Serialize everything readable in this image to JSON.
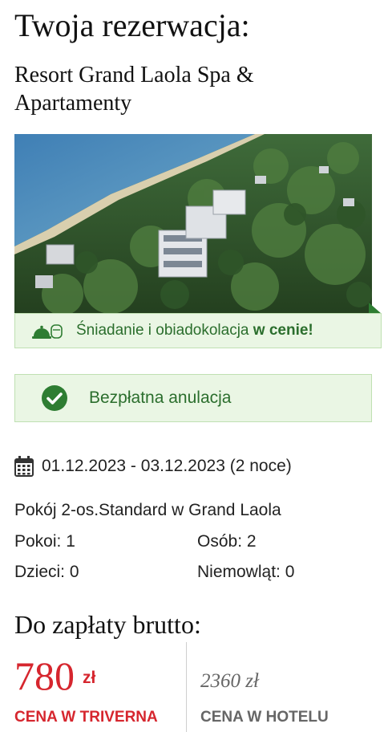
{
  "header": {
    "title": "Twoja rezerwacja:",
    "hotel_name": "Resort Grand Laola Spa & Apartamenty"
  },
  "photo": {
    "description_icon": "hotel-aerial-photo"
  },
  "meal_banner": {
    "text": "Śniadanie i obiadokolacja",
    "emphasis": "w cenie!",
    "icon": "meal-icon"
  },
  "cancellation": {
    "text": "Bezpłatna anulacja",
    "icon": "check-circle-icon"
  },
  "stay": {
    "dates": "01.12.2023 - 03.12.2023 (2 noce)",
    "icon": "calendar-icon"
  },
  "room": {
    "name": "Pokój 2-os.Standard w Grand Laola",
    "rooms": "Pokoi: 1",
    "persons": "Osób: 2",
    "children": "Dzieci: 0",
    "infants": "Niemowląt: 0"
  },
  "payment": {
    "title": "Do zapłaty brutto:",
    "price": "780",
    "currency": "zł",
    "price_label": "CENA W TRIVERNA",
    "hotel_price": "2360 zł",
    "hotel_label": "CENA W HOTELU"
  },
  "colors": {
    "accent_red": "#d6262e",
    "green_text": "#2b6e2d",
    "green_bg": "#eaf6e4",
    "green_border": "#bfe0b2"
  }
}
